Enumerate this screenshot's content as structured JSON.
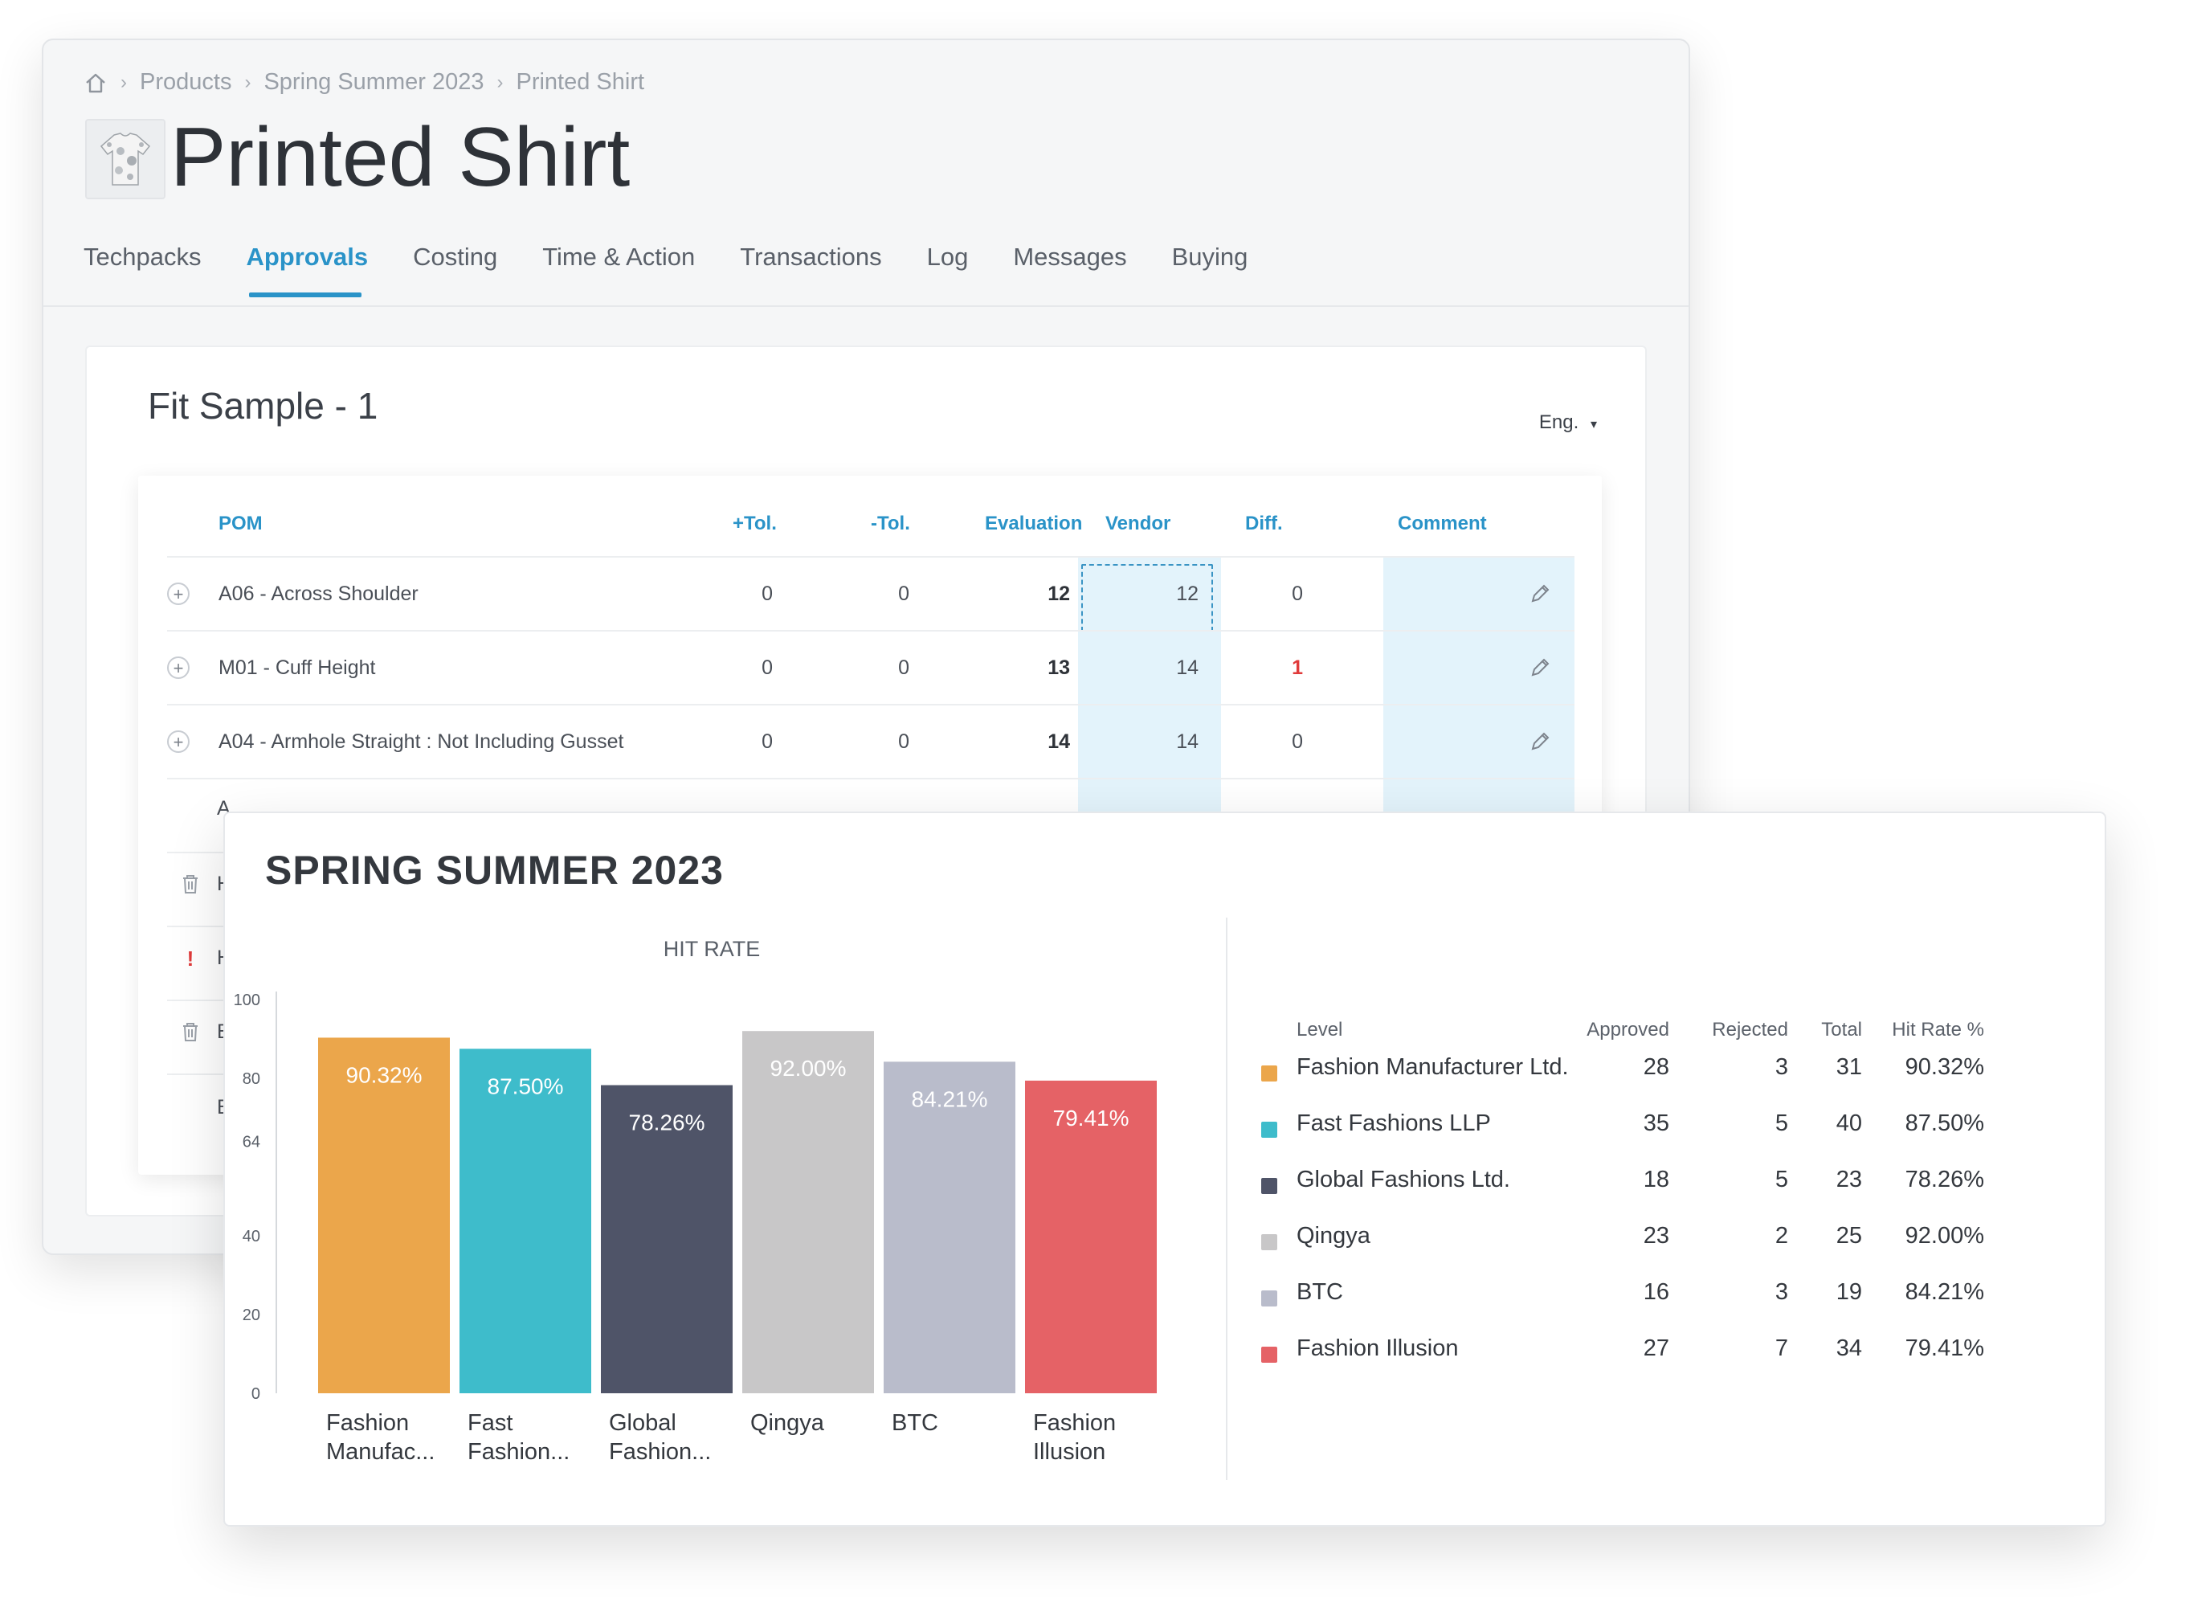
{
  "breadcrumb": {
    "items": [
      "Products",
      "Spring Summer 2023",
      "Printed Shirt"
    ]
  },
  "page_title": "Printed Shirt",
  "tabs": [
    {
      "label": "Techpacks",
      "active": false
    },
    {
      "label": "Approvals",
      "active": true
    },
    {
      "label": "Costing",
      "active": false
    },
    {
      "label": "Time & Action",
      "active": false
    },
    {
      "label": "Transactions",
      "active": false
    },
    {
      "label": "Log",
      "active": false
    },
    {
      "label": "Messages",
      "active": false
    },
    {
      "label": "Buying",
      "active": false
    }
  ],
  "fit_sample": {
    "title": "Fit Sample - 1",
    "language": "Eng.",
    "columns": {
      "pom": "POM",
      "plus_tol": "+Tol.",
      "minus_tol": "-Tol.",
      "evaluation": "Evaluation",
      "vendor": "Vendor",
      "diff": "Diff.",
      "comment": "Comment"
    },
    "rows": [
      {
        "pom": "A06 - Across Shoulder",
        "plus_tol": "0",
        "minus_tol": "0",
        "evaluation": "12",
        "vendor": "12",
        "diff": "0"
      },
      {
        "pom": "M01 - Cuff Height",
        "plus_tol": "0",
        "minus_tol": "0",
        "evaluation": "13",
        "vendor": "14",
        "diff": "1"
      },
      {
        "pom": "A04 - Armhole Straight : Not Including Gusset",
        "plus_tol": "0",
        "minus_tol": "0",
        "evaluation": "14",
        "vendor": "14",
        "diff": "0"
      }
    ],
    "hidden_row_stubs": [
      "A",
      "H",
      "H",
      "B",
      "B"
    ]
  },
  "report": {
    "title": "SPRING SUMMER 2023",
    "table_headers": {
      "level": "Level",
      "approved": "Approved",
      "rejected": "Rejected",
      "total": "Total",
      "hit_rate": "Hit Rate %"
    },
    "table_rows": [
      {
        "level": "Fashion Manufacturer Ltd.",
        "approved": "28",
        "rejected": "3",
        "total": "31",
        "hit_rate": "90.32%"
      },
      {
        "level": "Fast Fashions LLP",
        "approved": "35",
        "rejected": "5",
        "total": "40",
        "hit_rate": "87.50%"
      },
      {
        "level": "Global Fashions Ltd.",
        "approved": "18",
        "rejected": "5",
        "total": "23",
        "hit_rate": "78.26%"
      },
      {
        "level": "Qingya",
        "approved": "23",
        "rejected": "2",
        "total": "25",
        "hit_rate": "92.00%"
      },
      {
        "level": "BTC",
        "approved": "16",
        "rejected": "3",
        "total": "19",
        "hit_rate": "84.21%"
      },
      {
        "level": "Fashion Illusion",
        "approved": "27",
        "rejected": "7",
        "total": "34",
        "hit_rate": "79.41%"
      }
    ]
  },
  "chart_data": {
    "type": "bar",
    "title": "HIT RATE",
    "xlabel": "",
    "ylabel": "",
    "ylim": [
      0,
      100
    ],
    "yticks": [
      0,
      20,
      40,
      64,
      80,
      100
    ],
    "categories": [
      [
        "Fashion",
        "Manufac..."
      ],
      [
        "Fast",
        "Fashion..."
      ],
      [
        "Global",
        "Fashion..."
      ],
      [
        "Qingya"
      ],
      [
        "BTC"
      ],
      [
        "Fashion",
        "Illusion"
      ]
    ],
    "values": [
      90.32,
      87.5,
      78.26,
      92.0,
      84.21,
      79.41
    ],
    "value_labels": [
      "90.32%",
      "87.50%",
      "78.26%",
      "92.00%",
      "84.21%",
      "79.41%"
    ],
    "colors": [
      "#eba64b",
      "#3ebccb",
      "#4f5468",
      "#c8c7c8",
      "#b9bccb",
      "#e56266"
    ],
    "grid": false,
    "legend": "none"
  },
  "colors": {
    "accent": "#2a93c8",
    "diff_highlight": "#e03a3a",
    "vendor_column_bg": "#e3f3fb"
  }
}
